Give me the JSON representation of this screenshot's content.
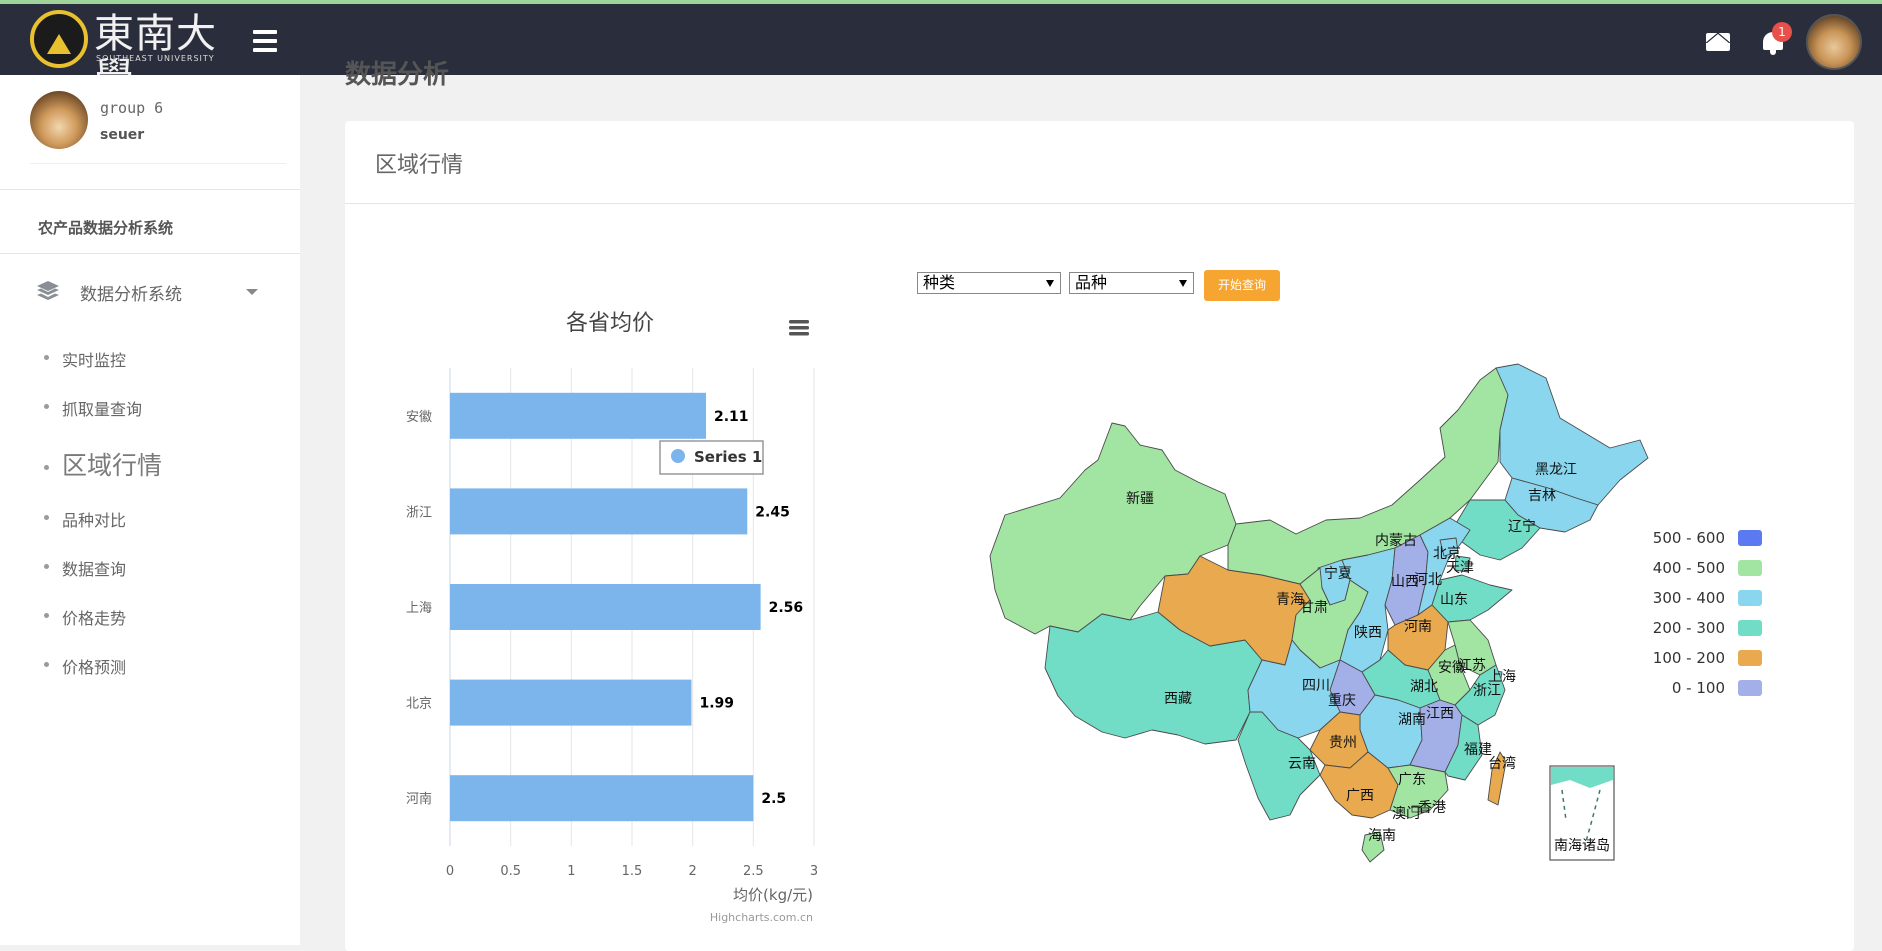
{
  "header": {
    "logo_text": "東南大學",
    "logo_sub": "SOUTHEAST UNIVERSITY",
    "notification_count": "1"
  },
  "sidebar": {
    "group_name": "group 6",
    "user_name": "seuer",
    "system_title": "农产品数据分析系统",
    "section_label": "数据分析系统",
    "items": [
      {
        "label": "实时监控"
      },
      {
        "label": "抓取量查询"
      },
      {
        "label": "区域行情",
        "active": true
      },
      {
        "label": "品种对比"
      },
      {
        "label": "数据查询"
      },
      {
        "label": "价格走势"
      },
      {
        "label": "价格预测"
      }
    ]
  },
  "main": {
    "page_title": "数据分析",
    "panel_title": "区域行情",
    "filters": {
      "category": "种类",
      "variety": "品种",
      "query_button": "开始查询"
    }
  },
  "chart_data": [
    {
      "type": "bar",
      "title": "各省均价",
      "categories": [
        "安徽",
        "浙江",
        "上海",
        "北京",
        "河南"
      ],
      "series": [
        {
          "name": "Series 1",
          "values": [
            2.11,
            2.45,
            2.56,
            1.99,
            2.5
          ]
        }
      ],
      "xlabel": "",
      "ylabel": "均价(kg/元)",
      "ylim": [
        0,
        3
      ],
      "ticks": [
        "0",
        "0.5",
        "1",
        "1.5",
        "2",
        "2.5",
        "3"
      ],
      "tooltip": "Series 1",
      "credit": "Highcharts.com.cn",
      "color": "#7cb5ec"
    },
    {
      "type": "map",
      "legend": [
        {
          "label": "500 - 600",
          "color": "#5b79f0"
        },
        {
          "label": "400 - 500",
          "color": "#a2e4a2"
        },
        {
          "label": "300 - 400",
          "color": "#89d6ee"
        },
        {
          "label": "200 - 300",
          "color": "#72ddc6"
        },
        {
          "label": "100 - 200",
          "color": "#e8a94f"
        },
        {
          "label": "0 - 100",
          "color": "#a3b0e8"
        }
      ],
      "regions": [
        {
          "name": "新疆"
        },
        {
          "name": "西藏"
        },
        {
          "name": "青海"
        },
        {
          "name": "甘肃"
        },
        {
          "name": "宁夏"
        },
        {
          "name": "内蒙古"
        },
        {
          "name": "黑龙江"
        },
        {
          "name": "吉林"
        },
        {
          "name": "辽宁"
        },
        {
          "name": "北京"
        },
        {
          "name": "天津"
        },
        {
          "name": "河北"
        },
        {
          "name": "山西"
        },
        {
          "name": "山东"
        },
        {
          "name": "陕西"
        },
        {
          "name": "河南"
        },
        {
          "name": "江苏"
        },
        {
          "name": "安徽"
        },
        {
          "name": "上海"
        },
        {
          "name": "浙江"
        },
        {
          "name": "湖北"
        },
        {
          "name": "四川"
        },
        {
          "name": "重庆"
        },
        {
          "name": "湖南"
        },
        {
          "name": "江西"
        },
        {
          "name": "贵州"
        },
        {
          "name": "云南"
        },
        {
          "name": "福建"
        },
        {
          "name": "台湾"
        },
        {
          "name": "广西"
        },
        {
          "name": "广东"
        },
        {
          "name": "香港"
        },
        {
          "name": "澳门"
        },
        {
          "name": "海南"
        },
        {
          "name": "南海诸岛"
        }
      ]
    }
  ]
}
